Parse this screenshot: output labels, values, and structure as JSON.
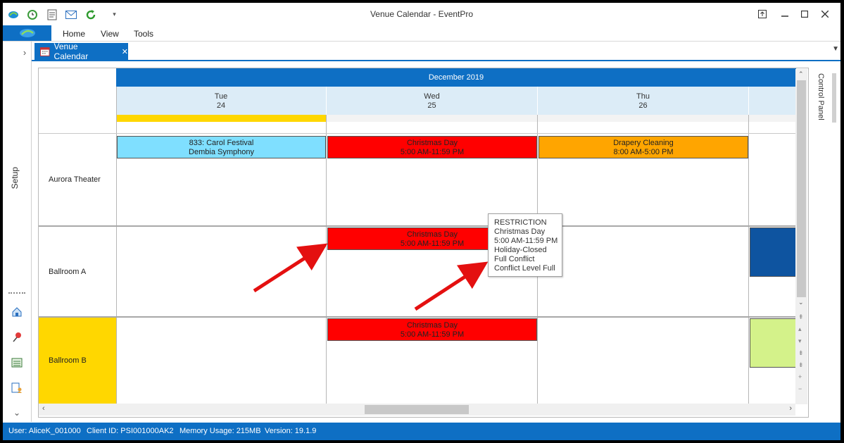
{
  "window": {
    "title": "Venue Calendar - EventPro"
  },
  "ribbon": {
    "menus": [
      "Home",
      "View",
      "Tools"
    ]
  },
  "rail": {
    "setup_label": "Setup"
  },
  "doc_tab": {
    "label": "Venue Calendar",
    "close": "✕"
  },
  "calendar": {
    "month": "December 2019",
    "days": [
      {
        "name": "Tue",
        "num": "24"
      },
      {
        "name": "Wed",
        "num": "25"
      },
      {
        "name": "Thu",
        "num": "26"
      }
    ],
    "venues": [
      "Aurora Theater",
      "Ballroom A",
      "Ballroom B"
    ],
    "events": [
      {
        "line1": "833: Carol Festival",
        "line2": "Dembia Symphony",
        "color": "#7fdfff"
      },
      {
        "line1": "Christmas Day",
        "line2": "5:00 AM-11:59 PM",
        "color": "#ff0000"
      },
      {
        "line1": "Drapery Cleaning",
        "line2": "8:00 AM-5:00 PM",
        "color": "#ffa500"
      },
      {
        "line1": "Christmas Day",
        "line2": "5:00 AM-11:59 PM",
        "color": "#ff0000"
      },
      {
        "line1": "Christmas Day",
        "line2": "5:00 AM-11:59 PM",
        "color": "#ff0000"
      }
    ],
    "tooltip": [
      "RESTRICTION",
      "Christmas Day",
      "5:00 AM-11:59 PM",
      "Holiday-Closed",
      "Full Conflict",
      "Conflict Level Full"
    ]
  },
  "control_panel": {
    "label": "Control Panel"
  },
  "status": {
    "user": "User: AliceK_001000",
    "client": "Client ID: PSI001000AK2",
    "memory": "Memory Usage: 215MB",
    "version": "Version: 19.1.9"
  },
  "colors": {
    "accent": "#0e6fc4",
    "highlight": "#ffd700"
  }
}
